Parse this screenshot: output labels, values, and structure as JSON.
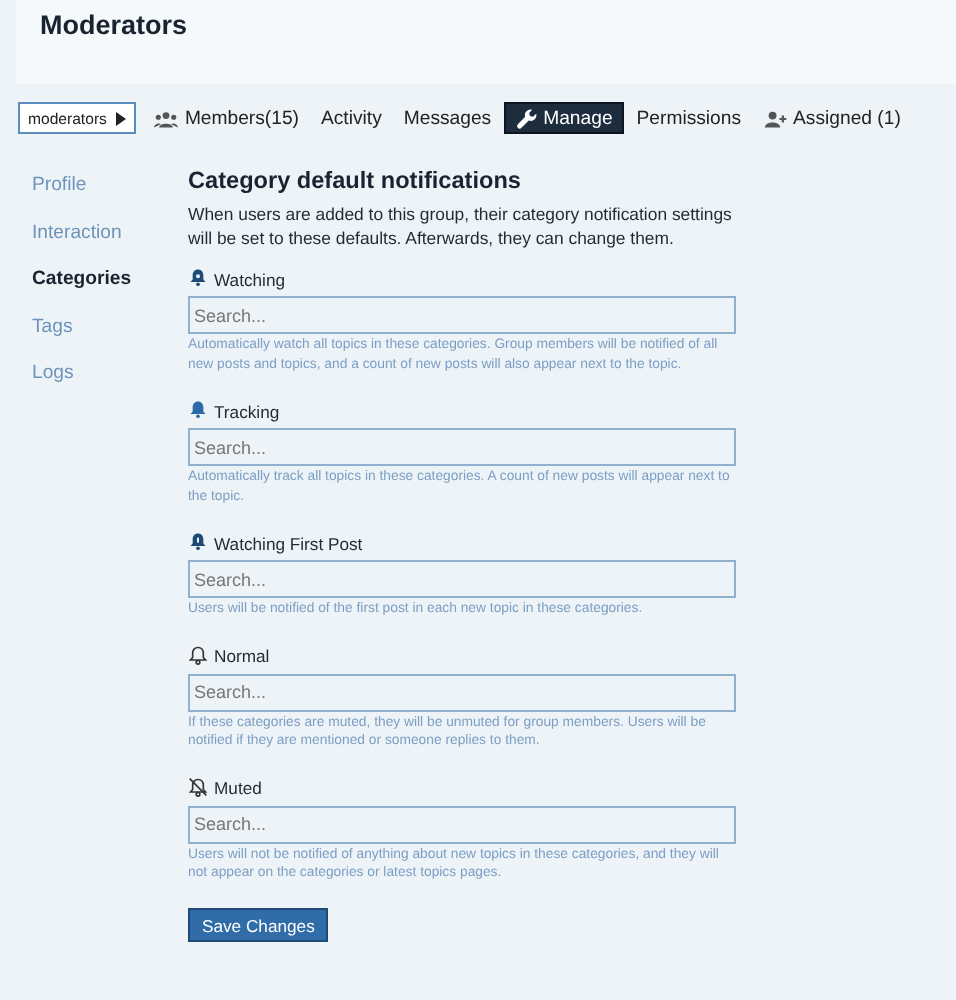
{
  "header": {
    "title": "Moderators"
  },
  "nav": [
    {
      "label": "moderators",
      "kind": "dropdown",
      "selected": false
    },
    {
      "label": "Members(15)",
      "kind": "people",
      "selected": false
    },
    {
      "label": "Activity",
      "kind": "plain",
      "selected": false
    },
    {
      "label": "Messages",
      "kind": "plain",
      "selected": false
    },
    {
      "label": "Manage",
      "kind": "wrench",
      "selected": true
    },
    {
      "label": "Permissions",
      "kind": "plain",
      "selected": false
    },
    {
      "label": "Assigned (1)",
      "kind": "person",
      "selected": false
    }
  ],
  "sidebar": {
    "items": [
      {
        "label": "Profile",
        "selected": false
      },
      {
        "label": "Interaction",
        "selected": false
      },
      {
        "label": "Categories",
        "selected": true
      },
      {
        "label": "Tags",
        "selected": false
      },
      {
        "label": "Logs",
        "selected": false
      }
    ]
  },
  "content": {
    "heading": "Category default notifications",
    "intro": "When users are added to this group, their category notification settings will be set to these defaults. Afterwards, they can change them.",
    "levels": [
      {
        "kind": "watching",
        "label": "Watching",
        "placeholder": "Search...",
        "help": "Automatically watch all topics in these categories. Group members will be notified of all new posts and topics, and a count of new posts will also appear next to the topic."
      },
      {
        "kind": "tracking",
        "label": "Tracking",
        "placeholder": "Search...",
        "help": "Automatically track all topics in these categories. A count of new posts will appear next to the topic."
      },
      {
        "kind": "first",
        "label": "Watching First Post",
        "placeholder": "Search...",
        "help": "Users will be notified of the first post in each new topic in these categories."
      },
      {
        "kind": "normal",
        "label": "Normal",
        "placeholder": "Search...",
        "help": "If these categories are muted, they will be unmuted for group members. Users will be notified if they are mentioned or someone replies to them."
      },
      {
        "kind": "muted",
        "label": "Muted",
        "placeholder": "Search...",
        "help": "Users will not be notified of anything about new topics in these categories, and they will not appear on the categories or latest topics pages."
      }
    ],
    "save_button": "Save Changes"
  }
}
